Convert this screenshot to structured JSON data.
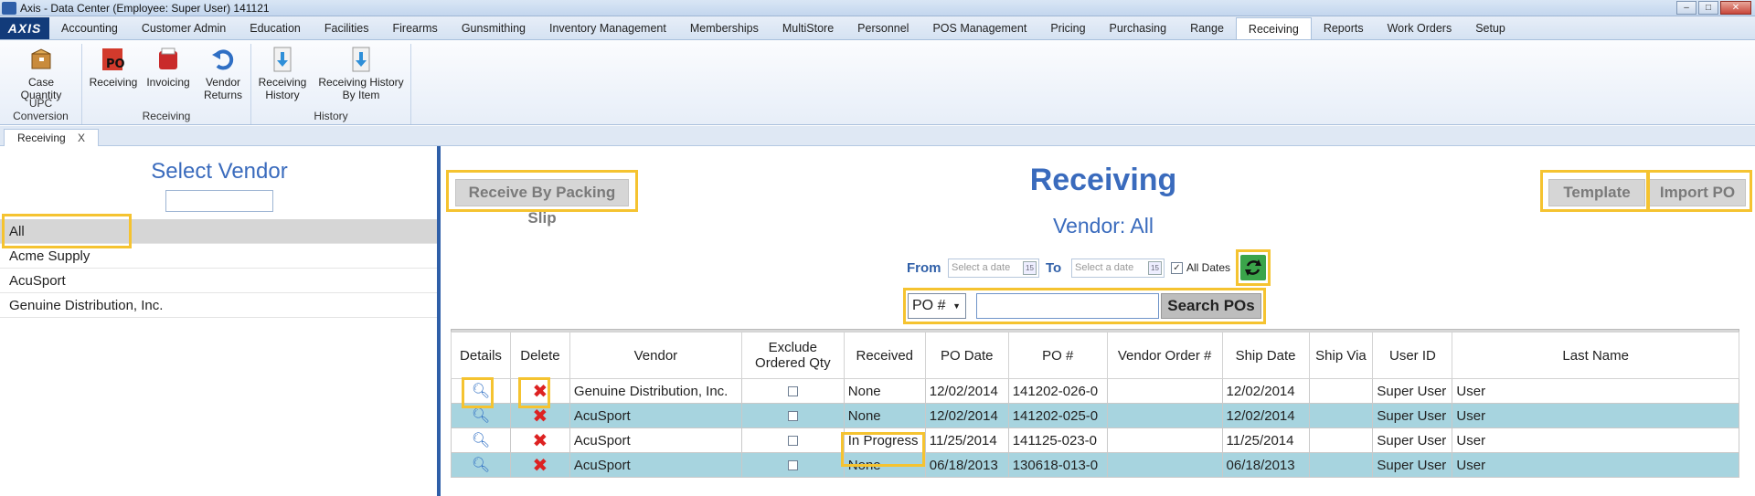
{
  "window": {
    "title": "Axis - Data Center  (Employee: Super User) 141121"
  },
  "menu": {
    "logo": "AXIS",
    "tabs": [
      "Accounting",
      "Customer Admin",
      "Education",
      "Facilities",
      "Firearms",
      "Gunsmithing",
      "Inventory Management",
      "Memberships",
      "MultiStore",
      "Personnel",
      "POS Management",
      "Pricing",
      "Purchasing",
      "Range",
      "Receiving",
      "Reports",
      "Work Orders",
      "Setup"
    ],
    "active": "Receiving"
  },
  "ribbon": {
    "groups": [
      {
        "label": "UPC Conversion",
        "buttons": [
          {
            "label1": "Case",
            "label2": "Quantity",
            "icon": "box-icon"
          }
        ]
      },
      {
        "label": "Receiving",
        "buttons": [
          {
            "label1": "Receiving",
            "label2": "",
            "icon": "po-icon"
          },
          {
            "label1": "Invoicing",
            "label2": "",
            "icon": "invoice-icon"
          },
          {
            "label1": "Vendor",
            "label2": "Returns",
            "icon": "return-arrow-icon"
          }
        ]
      },
      {
        "label": "History",
        "buttons": [
          {
            "label1": "Receiving",
            "label2": "History",
            "icon": "download-doc-icon"
          },
          {
            "label1": "Receiving History",
            "label2": "By Item",
            "icon": "download-doc-icon"
          }
        ]
      }
    ]
  },
  "doc_tab": {
    "label": "Receiving",
    "close": "X"
  },
  "left": {
    "title": "Select Vendor",
    "search_value": "",
    "vendors": [
      "All",
      "Acme Supply",
      "AcuSport",
      "Genuine Distribution, Inc."
    ],
    "selected": "All"
  },
  "main": {
    "title": "Receiving",
    "vendor_line": "Vendor: All",
    "receive_by_slip": "Receive By Packing Slip",
    "template": "Template",
    "import_po": "Import PO",
    "from_label": "From",
    "to_label": "To",
    "from_placeholder": "Select a date",
    "to_placeholder": "Select a date",
    "cal_glyph": "15",
    "all_dates_label": "All Dates",
    "all_dates_checked": "✓",
    "search_type": "PO #",
    "search_value": "",
    "search_button": "Search POs"
  },
  "table": {
    "headers": [
      "Details",
      "Delete",
      "Vendor",
      "Exclude Ordered Qty",
      "Received",
      "PO Date",
      "PO #",
      "Vendor Order #",
      "Ship Date",
      "Ship Via",
      "User ID",
      "Last Name"
    ],
    "rows": [
      {
        "vendor": "Genuine Distribution, Inc.",
        "received": "None",
        "po_date": "12/02/2014",
        "po_num": "141202-026-0",
        "vendor_order": "",
        "ship_date": "12/02/2014",
        "ship_via": "",
        "user_id": "Super User",
        "last_name": "User"
      },
      {
        "vendor": "AcuSport",
        "received": "None",
        "po_date": "12/02/2014",
        "po_num": "141202-025-0",
        "vendor_order": "",
        "ship_date": "12/02/2014",
        "ship_via": "",
        "user_id": "Super User",
        "last_name": "User"
      },
      {
        "vendor": "AcuSport",
        "received": "In Progress",
        "po_date": "11/25/2014",
        "po_num": "141125-023-0",
        "vendor_order": "",
        "ship_date": "11/25/2014",
        "ship_via": "",
        "user_id": "Super User",
        "last_name": "User"
      },
      {
        "vendor": "AcuSport",
        "received": "None",
        "po_date": "06/18/2013",
        "po_num": "130618-013-0",
        "vendor_order": "",
        "ship_date": "06/18/2013",
        "ship_via": "",
        "user_id": "Super User",
        "last_name": "User"
      }
    ]
  },
  "colors": {
    "accent": "#3a6bbd",
    "highlight": "#f5c330",
    "row_alt": "#a7d4df",
    "refresh": "#3aa44a"
  }
}
